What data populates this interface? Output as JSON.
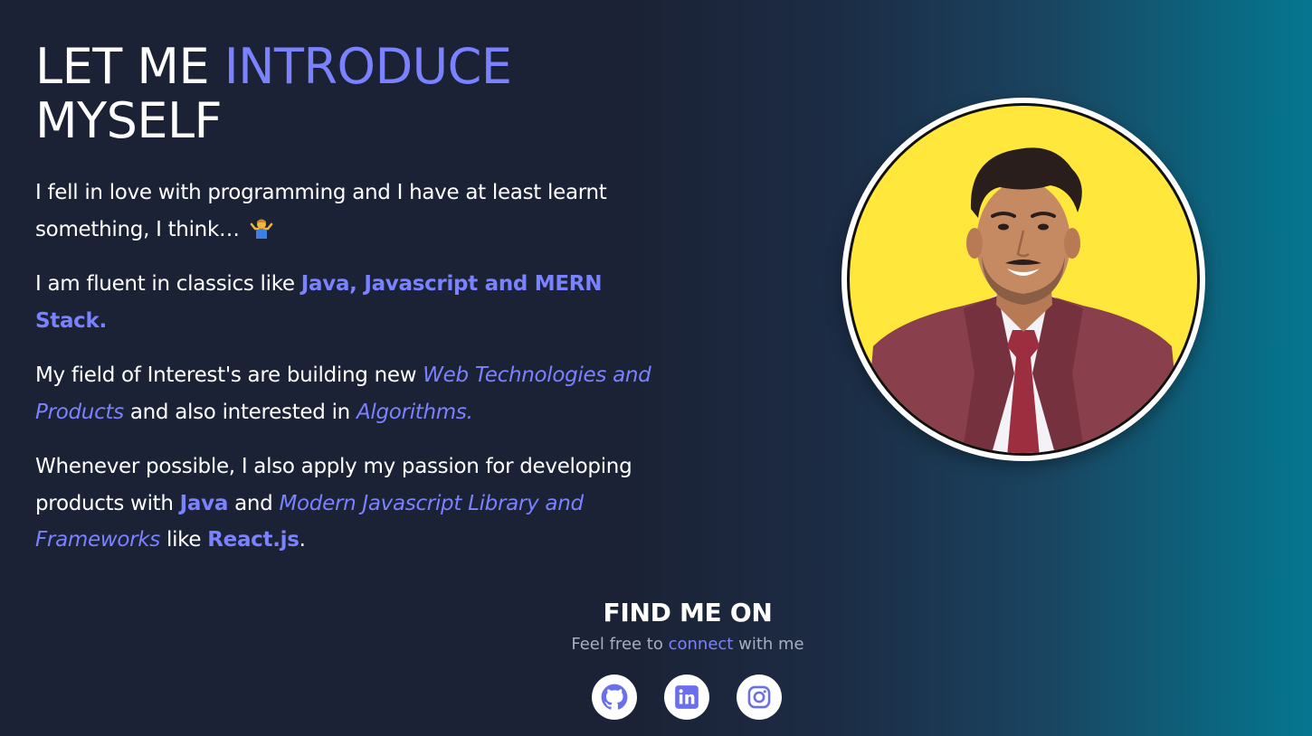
{
  "heading": {
    "line1_prefix": "LET ME ",
    "line1_accent": "INTRODUCE",
    "line2": "MYSELF"
  },
  "bio": {
    "p1": "I fell in love with programming and I have at least learnt something, I think… ",
    "p1_emoji": "person-shrugging-emoji",
    "p2_prefix": "I am fluent in classics like ",
    "p2_accent": "Java, Javascript and MERN Stack.",
    "p3_prefix": "My field of Interest's are building new ",
    "p3_accent1": "Web Technologies and Products",
    "p3_middle": " and also interested in ",
    "p3_accent2": "Algorithms.",
    "p4_prefix": "Whenever possible, I also apply my passion for developing products with ",
    "p4_accent1": "Java",
    "p4_and": " and ",
    "p4_accent2": "Modern Javascript Library and Frameworks",
    "p4_like": " like ",
    "p4_accent3": "React.js",
    "p4_end": "."
  },
  "find": {
    "title": "FIND ME ON",
    "sub_prefix": "Feel free to ",
    "sub_accent": "connect",
    "sub_suffix": " with me"
  },
  "social": {
    "items": [
      {
        "icon": "github-icon"
      },
      {
        "icon": "linkedin-icon"
      },
      {
        "icon": "instagram-icon"
      }
    ]
  },
  "colors": {
    "accent": "#7b82ff",
    "background_dark": "#1b2235",
    "background_teal": "#047790",
    "avatar_bg": "#ffe83b"
  }
}
